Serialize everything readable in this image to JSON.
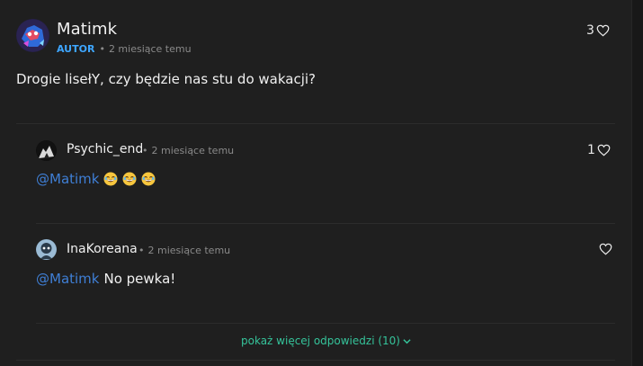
{
  "comment": {
    "author": "Matimk",
    "badge": "AUTOR",
    "time": "2 miesiące temu",
    "text": "Drogie lisełY, czy będzie nas stu do wakacji?",
    "likes": "3"
  },
  "replies": [
    {
      "author": "Psychic_end",
      "time": "2 miesiące temu",
      "mention": "@Matimk",
      "text": "",
      "emojis": [
        "laughing-emoji",
        "laughing-emoji",
        "laughing-emoji"
      ],
      "likes": "1"
    },
    {
      "author": "InaKoreana",
      "time": "2 miesiące temu",
      "mention": "@Matimk",
      "text": "No pewka!",
      "likes": ""
    }
  ],
  "more_replies_label": "pokaż więcej odpowiedzi (10)",
  "colors": {
    "author_badge": "#3ea6ff",
    "mention": "#3f7fd6",
    "more_link": "#35c39a"
  }
}
